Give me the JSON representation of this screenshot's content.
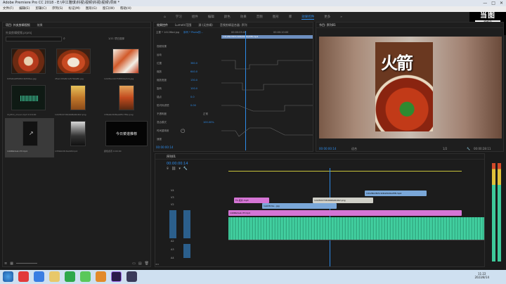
{
  "titlebar": {
    "text": "Adobe Premiere Pro CC 2018 - E:\\中江雅琪\\科视\\视频\\科视\\视频\\项目 *",
    "controls": [
      "—",
      "□",
      "✕"
    ]
  },
  "menu": [
    "文件(F)",
    "编辑(E)",
    "剪辑(C)",
    "序列(S)",
    "标记(M)",
    "图形(G)",
    "窗口(W)",
    "帮助(H)"
  ],
  "workspaces": [
    "学习",
    "组件",
    "编辑",
    "颜色",
    "效果",
    "音频",
    "图形",
    "库",
    "效果控件",
    "更多"
  ],
  "workspace_active": "效果控件",
  "logo": {
    "big": "当图",
    "sub": "视频号",
    "num": "8138828"
  },
  "project": {
    "tabs": [
      "项目: 外卖剪辑视频",
      "效果"
    ],
    "path": "外卖剪辑视频.prproj",
    "count": "1/11 项已选择",
    "items": [
      {
        "cap": "0d5a5e9f5682c6df18ee.jpg"
      },
      {
        "cap": "d5acc93a8c1a57b4a8b.jpg"
      },
      {
        "cap": "1c0d5e1d27fd83d2e3cb.jpg"
      },
      {
        "cap": "rhythm_music.mp3  0:16:00"
      },
      {
        "cap": "1c0d52d7d6d4b8e9b4b2.png"
      },
      {
        "cap": "13feb4c8d8ea9f3c7f6e.png"
      },
      {
        "cap": "14066cba1c7f.mp4"
      },
      {
        "cap": "13f4b0d3c6e49f.mp4"
      },
      {
        "cap": "颜色遮罩  0:00:00"
      }
    ],
    "mask_text": "今日菜谱推荐"
  },
  "efx": {
    "tabs": [
      "效果控件",
      "Lumetri范围",
      "源:(无剪辑)",
      "音频剪辑混合器: 序列"
    ],
    "clip": "主要 * 14126bd.jpg",
    "seq": "序列 * Photo的...",
    "time1": "00:00:05:00",
    "time2": "00:00:10:00",
    "clip_bar": "14126bd3b5c9d0a5b0ba5f8.mp4",
    "labels": [
      "视频效果",
      "运动",
      "位置",
      "缩放",
      "缩放宽度",
      "旋转",
      "锚点",
      "防闪烁滤镜",
      "不透明度",
      "混合模式",
      "时间重映射",
      "速度"
    ],
    "values": [
      "360.0",
      "640.0",
      "130.0",
      "100.0",
      "0.0",
      "0.00",
      "正常",
      "100.00%"
    ],
    "timecode": "00:00:00:14"
  },
  "program": {
    "tab": "节目: 序列01",
    "title_chars": "火箭",
    "timecode": "00:00:00:14",
    "fit": "适合",
    "quality": "1/2",
    "duration": "00:00:28:11"
  },
  "timeline": {
    "tab": "序列01",
    "timecode": "00:00:00:14",
    "tracks": [
      "V4",
      "V3",
      "V2",
      "V1",
      "A1",
      "A2",
      "A3",
      "A4"
    ],
    "clip1": "T1-名片.mp3",
    "clip2": "14126bd3b5c9d0a5b0ba5f8.mp4",
    "clip3": "1a9d3d1a...jpg",
    "clip4": "1c0d52d7d6d4b8e9b4b2.png",
    "clip5": "14066cba1c7f.mp4"
  },
  "taskbar": {
    "time": "11:22",
    "date": "2023/8/14"
  },
  "colors": {
    "accent": "#2d8ceb",
    "clip_pink": "#d575d5",
    "clip_blue": "#7aa7d8",
    "clip_green": "#3ec99a",
    "clip_yellow": "#c8c23a"
  }
}
